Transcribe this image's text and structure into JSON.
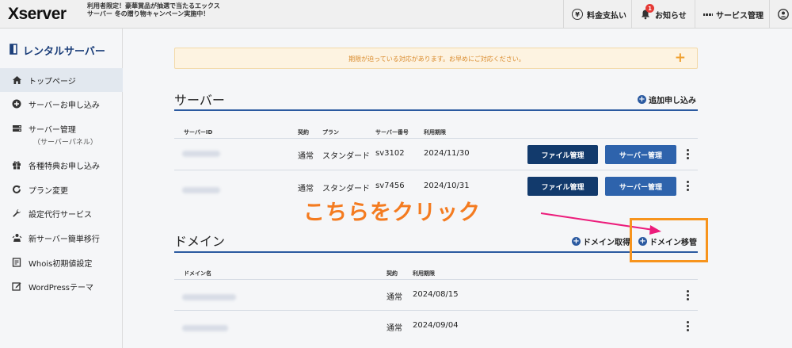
{
  "header": {
    "logo": "Xserver",
    "promo": "利用者限定！豪華賞品が抽選で当たるエックスサーバー 冬の贈り物キャンペーン実施中！",
    "billing": "料金支払い",
    "notifications": "お知らせ",
    "notification_count": "1",
    "services": "サービス管理",
    "yen_symbol": "¥"
  },
  "sidebar": {
    "title": "レンタルサーバー",
    "items": [
      {
        "label": "トップページ",
        "icon": "home-icon"
      },
      {
        "label": "サーバーお申し込み",
        "icon": "plus-circle-icon"
      },
      {
        "label": "サーバー管理",
        "sub": "（サーバーパネル）",
        "icon": "server-icon"
      },
      {
        "label": "各種特典お申し込み",
        "icon": "gift-icon"
      },
      {
        "label": "プラン変更",
        "icon": "refresh-icon"
      },
      {
        "label": "設定代行サービス",
        "icon": "wrench-icon"
      },
      {
        "label": "新サーバー簡単移行",
        "icon": "transfer-icon"
      },
      {
        "label": "Whois初期値設定",
        "icon": "document-icon"
      },
      {
        "label": "WordPressテーマ",
        "icon": "edit-icon"
      }
    ]
  },
  "notice": {
    "text": "期限が迫っている対応があります。お早めにご対応ください。",
    "plus": "+"
  },
  "server_section": {
    "title": "サーバー",
    "add_label": "追加申し込み",
    "columns": [
      "サーバーID",
      "契約",
      "プラン",
      "サーバー番号",
      "利用期限"
    ],
    "rows": [
      {
        "contract": "通常",
        "plan": "スタンダード",
        "server_no": "sv3102",
        "expiry": "2024/11/30"
      },
      {
        "contract": "通常",
        "plan": "スタンダード",
        "server_no": "sv7456",
        "expiry": "2024/10/31"
      }
    ],
    "file_btn": "ファイル管理",
    "server_btn": "サーバー管理"
  },
  "domain_section": {
    "title": "ドメイン",
    "acquire_label": "ドメイン取得",
    "transfer_label": "ドメイン移管",
    "columns": [
      "ドメイン名",
      "契約",
      "利用期限"
    ],
    "rows": [
      {
        "contract": "通常",
        "expiry": "2024/08/15"
      },
      {
        "contract": "通常",
        "expiry": "2024/09/04"
      }
    ]
  },
  "annotation": {
    "text": "こちらをクリック",
    "color": "#f47b20",
    "arrow_color": "#ec1c7b"
  }
}
